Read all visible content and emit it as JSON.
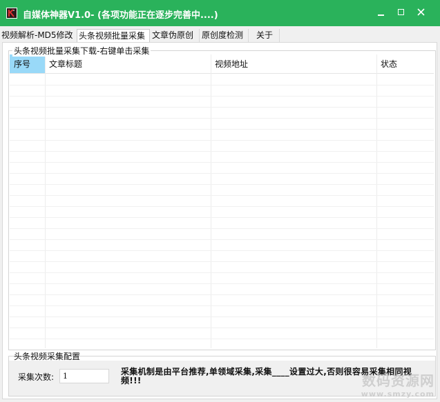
{
  "window": {
    "title": "自媒体神器V1.0- (各项功能正在逐步完善中....)",
    "minimize_glyph": "▬",
    "maximize_glyph": "□",
    "close_glyph": "✕"
  },
  "tabs": [
    {
      "label": "视频解析-MD5修改"
    },
    {
      "label": "头条视频批量采集"
    },
    {
      "label": "文章伪原创"
    },
    {
      "label": "原创度检测"
    },
    {
      "label": "关于"
    }
  ],
  "active_tab": "头条视频批量采集",
  "group_list": {
    "title": "头条视频批量采集下载-右键单击采集",
    "columns": [
      "序号",
      "文章标题",
      "视频地址",
      "状态"
    ],
    "rows": []
  },
  "group_config": {
    "title": "头条视频采集配置",
    "count_label": "采集次数:",
    "count_value": "1",
    "note": "采集机制是由平台推荐,单领域采集,采集____设置过大,否则很容易采集相同视频!!!"
  },
  "watermark": {
    "line1": "数码资源网",
    "line2": "www.smzy.com"
  },
  "colors": {
    "titlebar": "#2ab25b",
    "selected_header": "#99d9f8"
  }
}
